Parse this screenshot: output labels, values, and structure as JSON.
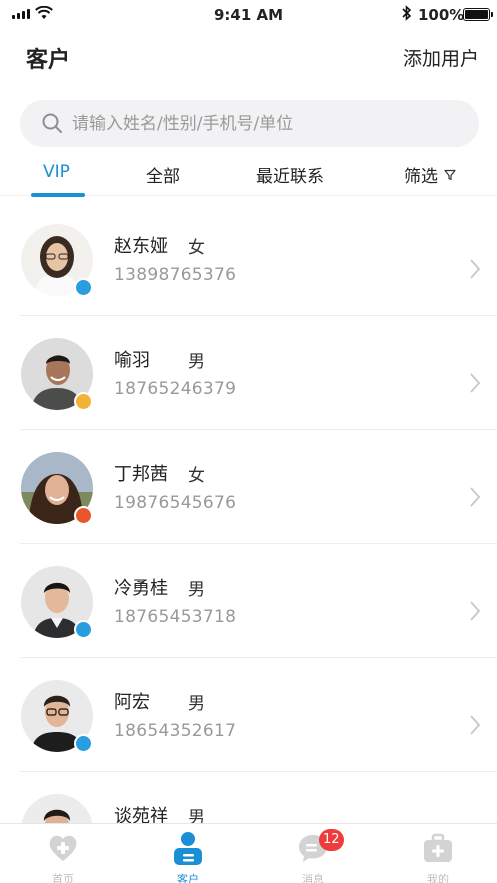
{
  "status_bar": {
    "time": "9:41 AM",
    "battery": "100%",
    "icons": [
      "signal-icon",
      "wifi-icon",
      "bluetooth-icon",
      "battery-icon"
    ]
  },
  "header": {
    "title": "客户",
    "action": "添加用户"
  },
  "search": {
    "placeholder": "请输入姓名/性别/手机号/单位",
    "value": ""
  },
  "tabs": [
    {
      "label": "VIP",
      "active": true
    },
    {
      "label": "全部",
      "active": false
    },
    {
      "label": "最近联系",
      "active": false
    },
    {
      "label": "筛选",
      "active": false,
      "icon": "filter-icon"
    }
  ],
  "contacts": [
    {
      "name": "赵东娅",
      "gender": "女",
      "phone": "13898765376",
      "status_color": "#2a9de0"
    },
    {
      "name": "喻羽",
      "gender": "男",
      "phone": "18765246379",
      "status_color": "#f2b233"
    },
    {
      "name": "丁邦茜",
      "gender": "女",
      "phone": "19876545676",
      "status_color": "#e8562a"
    },
    {
      "name": "冷勇桂",
      "gender": "男",
      "phone": "18765453718",
      "status_color": "#2a9de0"
    },
    {
      "name": "阿宏",
      "gender": "男",
      "phone": "18654352617",
      "status_color": "#2a9de0"
    },
    {
      "name": "谈苑祥",
      "gender": "男",
      "phone": "",
      "status_color": "#2a9de0"
    }
  ],
  "tabbar": [
    {
      "label": "首页",
      "icon": "heart-plus-icon",
      "active": false
    },
    {
      "label": "客户",
      "icon": "customer-icon",
      "active": true
    },
    {
      "label": "消息",
      "icon": "message-icon",
      "active": false,
      "badge": "12"
    },
    {
      "label": "我的",
      "icon": "medical-kit-icon",
      "active": false
    }
  ],
  "colors": {
    "accent": "#1b8fd6",
    "badge": "#ef3b3b"
  }
}
